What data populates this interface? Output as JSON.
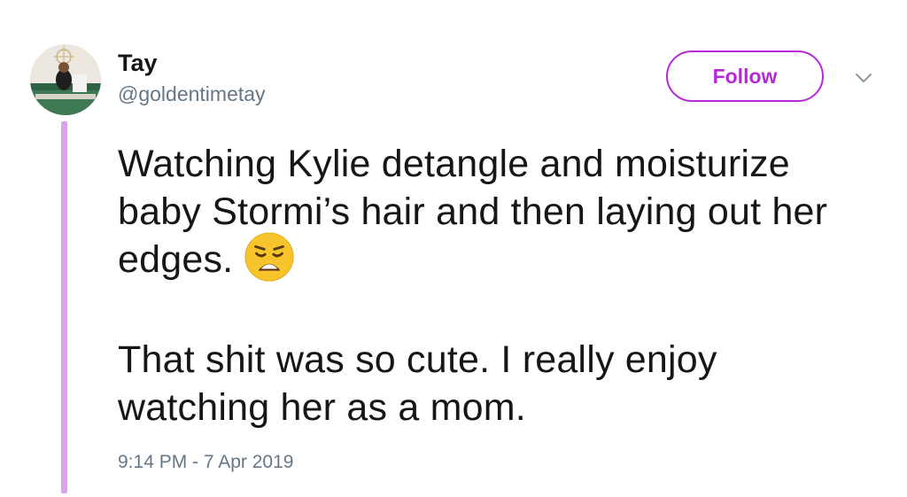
{
  "author": {
    "name": "Tay",
    "handle": "@goldentimetay"
  },
  "follow_button": {
    "label": "Follow"
  },
  "menu": {
    "icon": "chevron-down-icon"
  },
  "tweet": {
    "paragraph1": "Watching Kylie detangle and moisturize baby Stormi’s hair and then laying out her edges.",
    "emoji": "weary-face-emoji",
    "paragraph2": "That shit was so cute. I really enjoy watching her as a mom."
  },
  "timestamp": "9:14 PM - 7 Apr 2019",
  "colors": {
    "accent": "#b52ad6",
    "thread_line": "#dba3ee",
    "text_primary": "#14171a",
    "text_secondary": "#657786"
  }
}
